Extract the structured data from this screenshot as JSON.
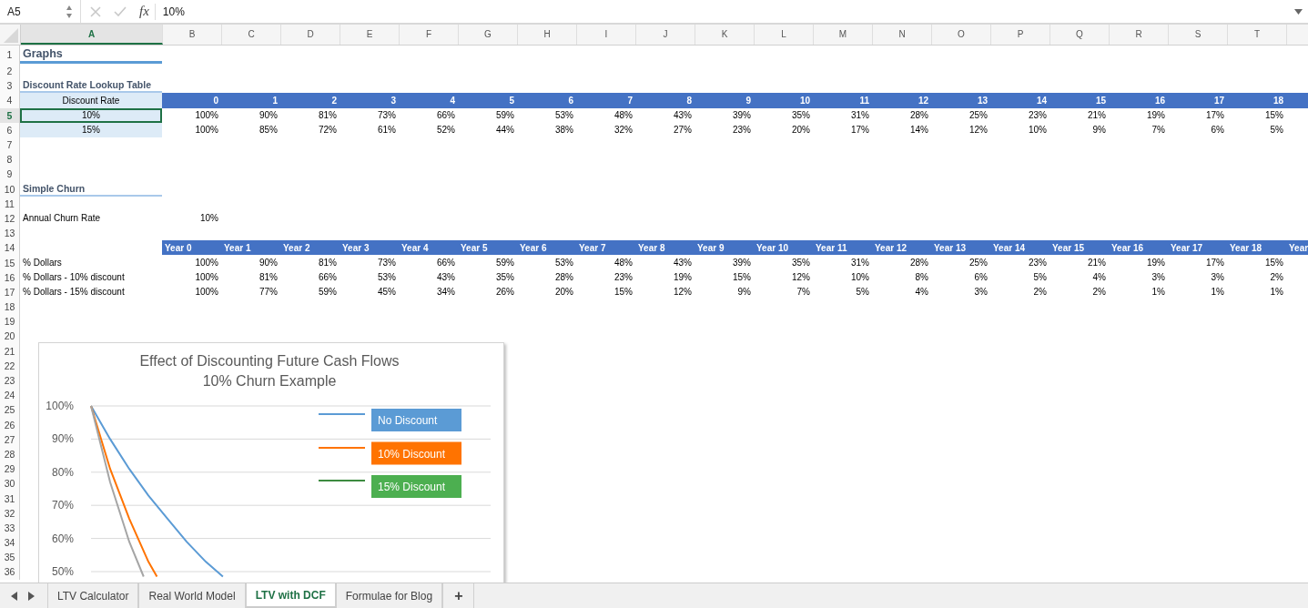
{
  "formula_bar": {
    "name_box": "A5",
    "function_label": "fx",
    "value": "10%"
  },
  "columns": [
    {
      "label": "A",
      "selected": true
    },
    {
      "label": "B",
      "selected": false
    },
    {
      "label": "C",
      "selected": false
    },
    {
      "label": "D",
      "selected": false
    },
    {
      "label": "E",
      "selected": false
    },
    {
      "label": "F",
      "selected": false
    },
    {
      "label": "G",
      "selected": false
    },
    {
      "label": "H",
      "selected": false
    },
    {
      "label": "I",
      "selected": false
    },
    {
      "label": "J",
      "selected": false
    },
    {
      "label": "K",
      "selected": false
    },
    {
      "label": "L",
      "selected": false
    },
    {
      "label": "M",
      "selected": false
    },
    {
      "label": "N",
      "selected": false
    },
    {
      "label": "O",
      "selected": false
    },
    {
      "label": "P",
      "selected": false
    },
    {
      "label": "Q",
      "selected": false
    },
    {
      "label": "R",
      "selected": false
    },
    {
      "label": "S",
      "selected": false
    },
    {
      "label": "T",
      "selected": false
    }
  ],
  "row_numbers": [
    {
      "label": "1",
      "selected": false
    },
    {
      "label": "2",
      "selected": false
    },
    {
      "label": "3",
      "selected": false
    },
    {
      "label": "4",
      "selected": false
    },
    {
      "label": "5",
      "selected": true
    },
    {
      "label": "6",
      "selected": false
    },
    {
      "label": "7",
      "selected": false
    },
    {
      "label": "8",
      "selected": false
    },
    {
      "label": "9",
      "selected": false
    },
    {
      "label": "10",
      "selected": false
    },
    {
      "label": "11",
      "selected": false
    },
    {
      "label": "12",
      "selected": false
    },
    {
      "label": "13",
      "selected": false
    },
    {
      "label": "14",
      "selected": false
    },
    {
      "label": "15",
      "selected": false
    },
    {
      "label": "16",
      "selected": false
    },
    {
      "label": "17",
      "selected": false
    },
    {
      "label": "18",
      "selected": false
    },
    {
      "label": "19",
      "selected": false
    },
    {
      "label": "20",
      "selected": false
    },
    {
      "label": "21",
      "selected": false
    },
    {
      "label": "22",
      "selected": false
    },
    {
      "label": "23",
      "selected": false
    },
    {
      "label": "24",
      "selected": false
    },
    {
      "label": "25",
      "selected": false
    },
    {
      "label": "26",
      "selected": false
    },
    {
      "label": "27",
      "selected": false
    },
    {
      "label": "28",
      "selected": false
    },
    {
      "label": "29",
      "selected": false
    },
    {
      "label": "30",
      "selected": false
    },
    {
      "label": "31",
      "selected": false
    },
    {
      "label": "32",
      "selected": false
    },
    {
      "label": "33",
      "selected": false
    },
    {
      "label": "34",
      "selected": false
    },
    {
      "label": "35",
      "selected": false
    },
    {
      "label": "36",
      "selected": false
    }
  ],
  "title": "Graphs",
  "lookup_table": {
    "title": "Discount Rate Lookup Table",
    "header_label": "Discount Rate",
    "periods": [
      "0",
      "1",
      "2",
      "3",
      "4",
      "5",
      "6",
      "7",
      "8",
      "9",
      "10",
      "11",
      "12",
      "13",
      "14",
      "15",
      "16",
      "17",
      "18"
    ],
    "rows": [
      {
        "rate": "10%",
        "selected": true,
        "values": [
          "100%",
          "90%",
          "81%",
          "73%",
          "66%",
          "59%",
          "53%",
          "48%",
          "43%",
          "39%",
          "35%",
          "31%",
          "28%",
          "25%",
          "23%",
          "21%",
          "19%",
          "17%",
          "15%"
        ]
      },
      {
        "rate": "15%",
        "selected": false,
        "values": [
          "100%",
          "85%",
          "72%",
          "61%",
          "52%",
          "44%",
          "38%",
          "32%",
          "27%",
          "23%",
          "20%",
          "17%",
          "14%",
          "12%",
          "10%",
          "9%",
          "7%",
          "6%",
          "5%"
        ]
      }
    ]
  },
  "simple_churn": {
    "title": "Simple Churn",
    "churn_rate": {
      "label": "Annual Churn Rate",
      "value": "10%"
    },
    "years": [
      "Year 0",
      "Year 1",
      "Year 2",
      "Year 3",
      "Year 4",
      "Year 5",
      "Year 6",
      "Year 7",
      "Year 8",
      "Year 9",
      "Year 10",
      "Year 11",
      "Year 12",
      "Year 13",
      "Year 14",
      "Year 15",
      "Year 16",
      "Year 17",
      "Year 18",
      "Year"
    ],
    "rows": [
      {
        "label": "% Dollars",
        "values": [
          "100%",
          "90%",
          "81%",
          "73%",
          "66%",
          "59%",
          "53%",
          "48%",
          "43%",
          "39%",
          "35%",
          "31%",
          "28%",
          "25%",
          "23%",
          "21%",
          "19%",
          "17%",
          "15%"
        ]
      },
      {
        "label": "% Dollars - 10% discount",
        "values": [
          "100%",
          "81%",
          "66%",
          "53%",
          "43%",
          "35%",
          "28%",
          "23%",
          "19%",
          "15%",
          "12%",
          "10%",
          "8%",
          "6%",
          "5%",
          "4%",
          "3%",
          "3%",
          "2%"
        ]
      },
      {
        "label": "% Dollars - 15% discount",
        "values": [
          "100%",
          "77%",
          "59%",
          "45%",
          "34%",
          "26%",
          "20%",
          "15%",
          "12%",
          "9%",
          "7%",
          "5%",
          "4%",
          "3%",
          "2%",
          "2%",
          "1%",
          "1%",
          "1%"
        ]
      }
    ]
  },
  "chart": {
    "title_lines": [
      "Effect of Discounting Future Cash Flows",
      "10% Churn Example"
    ],
    "axis_labels": [
      "100%",
      "90%",
      "80%",
      "70%",
      "60%",
      "50%"
    ],
    "legend_lines": [
      {
        "color": "#5b9bd5"
      },
      {
        "color": "#ff7300"
      },
      {
        "color": "#3d8b40"
      }
    ],
    "legend": [
      {
        "label": "No Discount",
        "color": "#5b9bd5"
      },
      {
        "label": "10% Discount",
        "color": "#ff7300"
      },
      {
        "label": "15% Discount",
        "color": "#4caf50"
      }
    ]
  },
  "sheet_tabs": [
    {
      "label": "LTV Calculator",
      "selected": false
    },
    {
      "label": "Real World Model",
      "selected": false
    },
    {
      "label": "LTV with DCF",
      "selected": true
    },
    {
      "label": "Formulae for Blog",
      "selected": false
    }
  ],
  "add_sheet": "+"
}
